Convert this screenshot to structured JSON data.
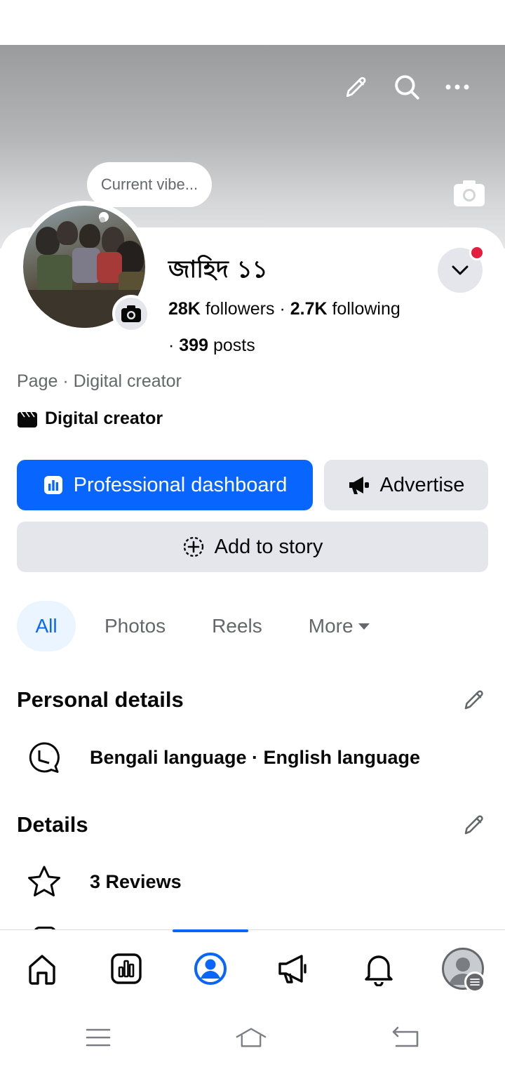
{
  "header": {
    "edit_icon": "pencil-icon",
    "search_icon": "search-icon",
    "more_icon": "more-horizontal-icon"
  },
  "profile": {
    "vibe_placeholder": "Current vibe...",
    "name": "জাহিদ ১১",
    "followers_count": "28K",
    "followers_label": "followers",
    "following_count": "2.7K",
    "following_label": "following",
    "posts_count": "399",
    "posts_label": "posts",
    "page_category": "Page · Digital creator",
    "creator_label": "Digital creator"
  },
  "actions": {
    "dashboard_label": "Professional dashboard",
    "advertise_label": "Advertise",
    "story_label": "Add to story"
  },
  "tabs": [
    {
      "label": "All",
      "active": true
    },
    {
      "label": "Photos",
      "active": false
    },
    {
      "label": "Reels",
      "active": false
    },
    {
      "label": "More",
      "active": false
    }
  ],
  "sections": {
    "personal_title": "Personal details",
    "languages": "Bengali language · English language",
    "details_title": "Details",
    "reviews": "3 Reviews"
  },
  "bottom_nav": [
    {
      "name": "home",
      "icon": "home-icon"
    },
    {
      "name": "dashboard",
      "icon": "chart-icon"
    },
    {
      "name": "profile",
      "icon": "profile-icon",
      "active": true
    },
    {
      "name": "ads",
      "icon": "megaphone-icon"
    },
    {
      "name": "notifications",
      "icon": "bell-icon"
    },
    {
      "name": "menu",
      "icon": "avatar-menu-icon"
    }
  ],
  "colors": {
    "accent": "#0866ff",
    "notification_dot": "#e41e3f",
    "secondary_text": "#65676b",
    "button_gray": "#e4e6eb"
  }
}
